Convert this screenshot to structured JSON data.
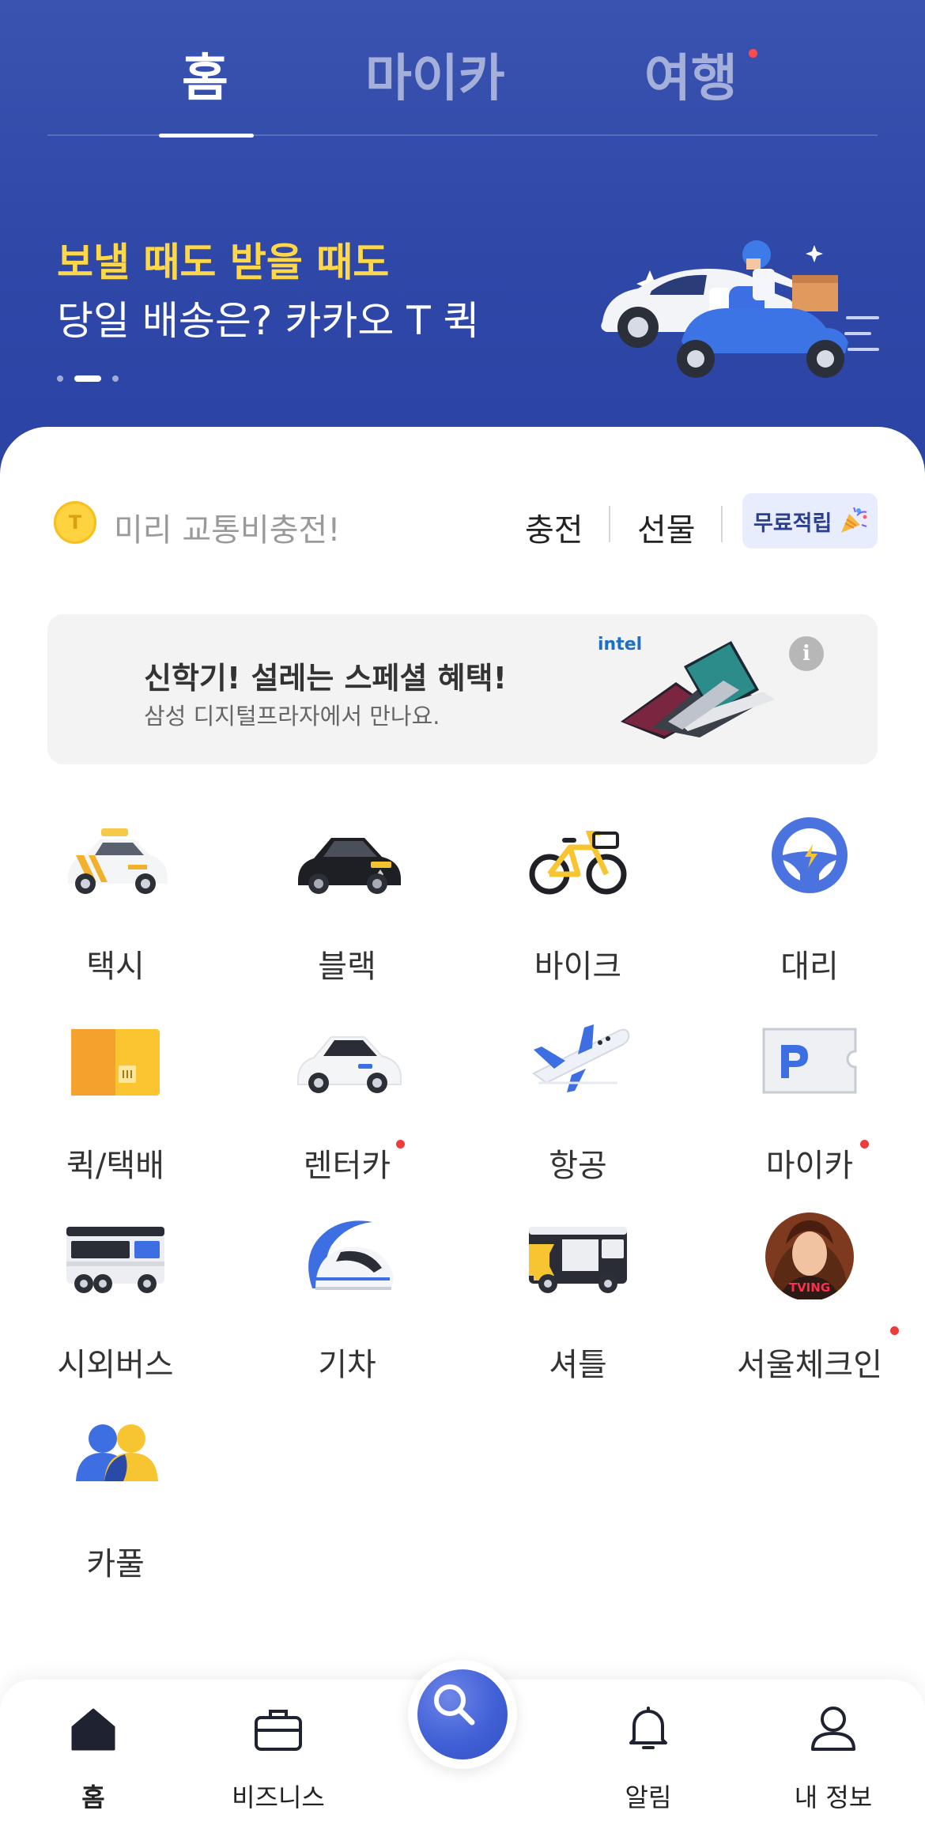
{
  "top_tabs": {
    "home": "홈",
    "mycar": "마이카",
    "travel": "여행"
  },
  "banner": {
    "title": "보낼 때도 받을 때도",
    "subtitle": "당일 배송은? 카카오 T 퀵",
    "page_indicator": {
      "current": 2,
      "total": 3
    }
  },
  "charge": {
    "coin_label": "T",
    "text": "미리 교통비충전!",
    "charge_link": "충전",
    "gift_link": "선물",
    "free_button": "무료적립"
  },
  "ad": {
    "brand": "intel",
    "title": "신학기! 설레는 스페셜 혜택!",
    "subtitle": "삼성 디지털프라자에서 만나요.",
    "info_icon": "i"
  },
  "services": [
    {
      "label": "택시",
      "icon": "taxi-icon",
      "new": false
    },
    {
      "label": "블랙",
      "icon": "black-car-icon",
      "new": false
    },
    {
      "label": "바이크",
      "icon": "bike-icon",
      "new": false
    },
    {
      "label": "대리",
      "icon": "steering-wheel-icon",
      "new": false
    },
    {
      "label": "퀵/택배",
      "icon": "parcel-box-icon",
      "new": false
    },
    {
      "label": "렌터카",
      "icon": "rental-car-icon",
      "new": true
    },
    {
      "label": "항공",
      "icon": "airplane-icon",
      "new": false
    },
    {
      "label": "마이카",
      "icon": "parking-icon",
      "new": true
    },
    {
      "label": "시외버스",
      "icon": "bus-icon",
      "new": false
    },
    {
      "label": "기차",
      "icon": "train-icon",
      "new": false
    },
    {
      "label": "셔틀",
      "icon": "shuttle-icon",
      "new": false
    },
    {
      "label": "서울체크인",
      "icon": "tving-portrait-icon",
      "new": true
    },
    {
      "label": "카풀",
      "icon": "carpool-icon",
      "new": false
    }
  ],
  "tving_text": "TVING",
  "bottom_nav": {
    "home": "홈",
    "business": "비즈니스",
    "search": "search-icon",
    "alerts": "알림",
    "profile": "내 정보"
  },
  "colors": {
    "hero_bg": "#2f48a8",
    "banner_title": "#ffd84a",
    "accent_blue": "#4160d6",
    "new_dot": "#ee3b3b"
  }
}
